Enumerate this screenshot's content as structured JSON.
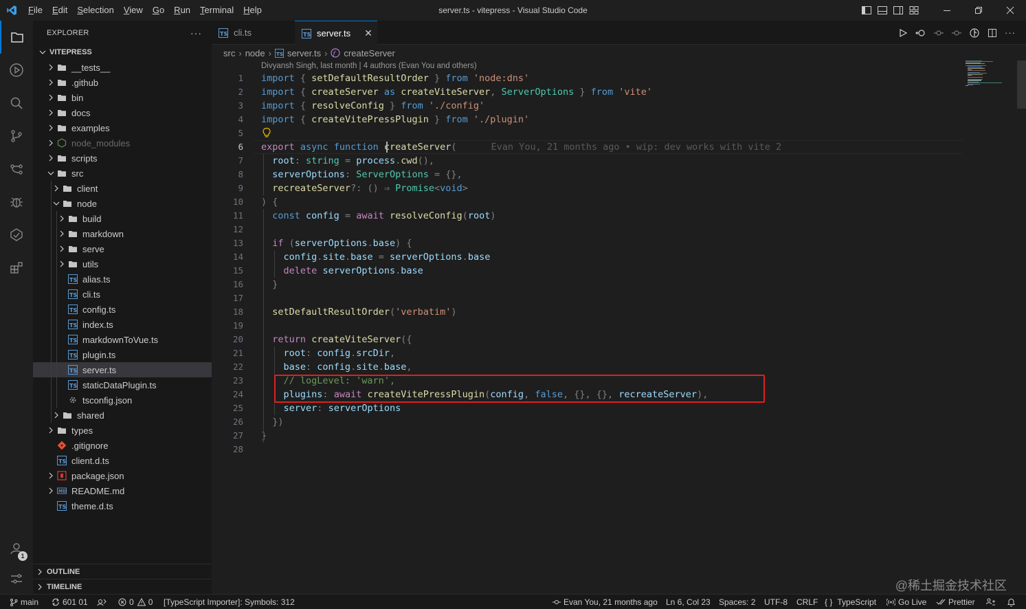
{
  "window": {
    "title": "server.ts - vitepress - Visual Studio Code",
    "menu": [
      {
        "first": "F",
        "rest": "ile"
      },
      {
        "first": "E",
        "rest": "dit"
      },
      {
        "first": "S",
        "rest": "election"
      },
      {
        "first": "V",
        "rest": "iew"
      },
      {
        "first": "G",
        "rest": "o"
      },
      {
        "first": "R",
        "rest": "un"
      },
      {
        "first": "T",
        "rest": "erminal"
      },
      {
        "first": "H",
        "rest": "elp"
      }
    ]
  },
  "sidebar": {
    "title": "EXPLORER",
    "root": "VITEPRESS",
    "outline": "OUTLINE",
    "timeline": "TIMELINE",
    "tree": [
      {
        "label": "__tests__",
        "depth": 0,
        "kind": "folder",
        "open": false
      },
      {
        "label": ".github",
        "depth": 0,
        "kind": "folder",
        "open": false
      },
      {
        "label": "bin",
        "depth": 0,
        "kind": "folder",
        "open": false
      },
      {
        "label": "docs",
        "depth": 0,
        "kind": "folder",
        "open": false
      },
      {
        "label": "examples",
        "depth": 0,
        "kind": "folder",
        "open": false
      },
      {
        "label": "node_modules",
        "depth": 0,
        "kind": "node-folder",
        "open": false,
        "dim": true
      },
      {
        "label": "scripts",
        "depth": 0,
        "kind": "folder",
        "open": false
      },
      {
        "label": "src",
        "depth": 0,
        "kind": "folder",
        "open": true
      },
      {
        "label": "client",
        "depth": 1,
        "kind": "folder",
        "open": false
      },
      {
        "label": "node",
        "depth": 1,
        "kind": "folder",
        "open": true
      },
      {
        "label": "build",
        "depth": 2,
        "kind": "folder",
        "open": false
      },
      {
        "label": "markdown",
        "depth": 2,
        "kind": "folder",
        "open": false
      },
      {
        "label": "serve",
        "depth": 2,
        "kind": "folder",
        "open": false
      },
      {
        "label": "utils",
        "depth": 2,
        "kind": "folder",
        "open": false
      },
      {
        "label": "alias.ts",
        "depth": 2,
        "kind": "ts"
      },
      {
        "label": "cli.ts",
        "depth": 2,
        "kind": "ts"
      },
      {
        "label": "config.ts",
        "depth": 2,
        "kind": "ts"
      },
      {
        "label": "index.ts",
        "depth": 2,
        "kind": "ts"
      },
      {
        "label": "markdownToVue.ts",
        "depth": 2,
        "kind": "ts"
      },
      {
        "label": "plugin.ts",
        "depth": 2,
        "kind": "ts"
      },
      {
        "label": "server.ts",
        "depth": 2,
        "kind": "ts",
        "selected": true
      },
      {
        "label": "staticDataPlugin.ts",
        "depth": 2,
        "kind": "ts"
      },
      {
        "label": "tsconfig.json",
        "depth": 2,
        "kind": "tsconfig"
      },
      {
        "label": "shared",
        "depth": 1,
        "kind": "folder",
        "open": false
      },
      {
        "label": "types",
        "depth": 0,
        "kind": "folder",
        "open": false
      },
      {
        "label": ".gitignore",
        "depth": 0,
        "kind": "git"
      },
      {
        "label": "client.d.ts",
        "depth": 0,
        "kind": "ts"
      },
      {
        "label": "package.json",
        "depth": 0,
        "kind": "npm",
        "chevron": true
      },
      {
        "label": "README.md",
        "depth": 0,
        "kind": "md",
        "chevron": true
      },
      {
        "label": "theme.d.ts",
        "depth": 0,
        "kind": "ts"
      }
    ]
  },
  "tabs": [
    {
      "label": "cli.ts",
      "active": false
    },
    {
      "label": "server.ts",
      "active": true
    }
  ],
  "breadcrumb": {
    "a": "src",
    "b": "node",
    "c": "server.ts",
    "d": "createServer"
  },
  "codelens": "Divyansh Singh, last month | 4 authors (Evan You and others)",
  "blame_inline": "Evan You, 21 months ago • wip: dev works with vite 2",
  "code_lines": [
    [
      [
        "kb",
        "import"
      ],
      [
        "pc",
        " { "
      ],
      [
        "fn",
        "setDefaultResultOrder"
      ],
      [
        "pc",
        " } "
      ],
      [
        "kb",
        "from"
      ],
      [
        "str",
        " 'node:dns'"
      ]
    ],
    [
      [
        "kb",
        "import"
      ],
      [
        "pc",
        " { "
      ],
      [
        "fn",
        "createServer"
      ],
      [
        "kb",
        " as "
      ],
      [
        "fn",
        "createViteServer"
      ],
      [
        "pc",
        ", "
      ],
      [
        "ty",
        "ServerOptions"
      ],
      [
        "pc",
        " } "
      ],
      [
        "kb",
        "from"
      ],
      [
        "str",
        " 'vite'"
      ]
    ],
    [
      [
        "kb",
        "import"
      ],
      [
        "pc",
        " { "
      ],
      [
        "fn",
        "resolveConfig"
      ],
      [
        "pc",
        " } "
      ],
      [
        "kb",
        "from"
      ],
      [
        "str",
        " './config'"
      ]
    ],
    [
      [
        "kb",
        "import"
      ],
      [
        "pc",
        " { "
      ],
      [
        "fn",
        "createVitePressPlugin"
      ],
      [
        "pc",
        " } "
      ],
      [
        "kb",
        "from"
      ],
      [
        "str",
        " './plugin'"
      ]
    ],
    [],
    [
      [
        "k",
        "export"
      ],
      [
        "kb",
        " async"
      ],
      [
        "kb",
        " function"
      ],
      [
        "pc",
        " "
      ],
      [
        "fn",
        "createServer"
      ],
      [
        "pc",
        "("
      ]
    ],
    [
      [
        "pc",
        "  "
      ],
      [
        "vr",
        "root"
      ],
      [
        "pc",
        ": "
      ],
      [
        "ty",
        "string"
      ],
      [
        "pc",
        " = "
      ],
      [
        "vr",
        "process"
      ],
      [
        "pc",
        "."
      ],
      [
        "fn",
        "cwd"
      ],
      [
        "pc",
        "(),"
      ]
    ],
    [
      [
        "pc",
        "  "
      ],
      [
        "vr",
        "serverOptions"
      ],
      [
        "pc",
        ": "
      ],
      [
        "ty",
        "ServerOptions"
      ],
      [
        "pc",
        " = {},"
      ]
    ],
    [
      [
        "pc",
        "  "
      ],
      [
        "fn",
        "recreateServer"
      ],
      [
        "pc",
        "?: () ⇒ "
      ],
      [
        "ty",
        "Promise"
      ],
      [
        "pc",
        "<"
      ],
      [
        "kb",
        "void"
      ],
      [
        "pc",
        ">"
      ]
    ],
    [
      [
        "pc",
        ") {"
      ]
    ],
    [
      [
        "pc",
        "  "
      ],
      [
        "kb",
        "const"
      ],
      [
        "pc",
        " "
      ],
      [
        "vr",
        "config"
      ],
      [
        "pc",
        " = "
      ],
      [
        "k",
        "await"
      ],
      [
        "pc",
        " "
      ],
      [
        "fn",
        "resolveConfig"
      ],
      [
        "pc",
        "("
      ],
      [
        "vr",
        "root"
      ],
      [
        "pc",
        ")"
      ]
    ],
    [],
    [
      [
        "pc",
        "  "
      ],
      [
        "k",
        "if"
      ],
      [
        "pc",
        " ("
      ],
      [
        "vr",
        "serverOptions"
      ],
      [
        "pc",
        "."
      ],
      [
        "vr",
        "base"
      ],
      [
        "pc",
        ") {"
      ]
    ],
    [
      [
        "pc",
        "    "
      ],
      [
        "vr",
        "config"
      ],
      [
        "pc",
        "."
      ],
      [
        "vr",
        "site"
      ],
      [
        "pc",
        "."
      ],
      [
        "vr",
        "base"
      ],
      [
        "pc",
        " = "
      ],
      [
        "vr",
        "serverOptions"
      ],
      [
        "pc",
        "."
      ],
      [
        "vr",
        "base"
      ]
    ],
    [
      [
        "pc",
        "    "
      ],
      [
        "k",
        "delete"
      ],
      [
        "pc",
        " "
      ],
      [
        "vr",
        "serverOptions"
      ],
      [
        "pc",
        "."
      ],
      [
        "vr",
        "base"
      ]
    ],
    [
      [
        "pc",
        "  }"
      ]
    ],
    [],
    [
      [
        "pc",
        "  "
      ],
      [
        "fn",
        "setDefaultResultOrder"
      ],
      [
        "pc",
        "("
      ],
      [
        "str",
        "'verbatim'"
      ],
      [
        "pc",
        ")"
      ]
    ],
    [],
    [
      [
        "pc",
        "  "
      ],
      [
        "k",
        "return"
      ],
      [
        "pc",
        " "
      ],
      [
        "fn",
        "createViteServer"
      ],
      [
        "pc",
        "({"
      ]
    ],
    [
      [
        "pc",
        "    "
      ],
      [
        "vr",
        "root"
      ],
      [
        "pc",
        ": "
      ],
      [
        "vr",
        "config"
      ],
      [
        "pc",
        "."
      ],
      [
        "vr",
        "srcDir"
      ],
      [
        "pc",
        ","
      ]
    ],
    [
      [
        "pc",
        "    "
      ],
      [
        "vr",
        "base"
      ],
      [
        "pc",
        ": "
      ],
      [
        "vr",
        "config"
      ],
      [
        "pc",
        "."
      ],
      [
        "vr",
        "site"
      ],
      [
        "pc",
        "."
      ],
      [
        "vr",
        "base"
      ],
      [
        "pc",
        ","
      ]
    ],
    [
      [
        "pc",
        "    "
      ],
      [
        "cm",
        "// logLevel: 'warn',"
      ]
    ],
    [
      [
        "pc",
        "    "
      ],
      [
        "vr",
        "plugins"
      ],
      [
        "pc",
        ": "
      ],
      [
        "k",
        "await"
      ],
      [
        "pc",
        " "
      ],
      [
        "fn",
        "createVitePressPlugin"
      ],
      [
        "pc",
        "("
      ],
      [
        "vr",
        "config"
      ],
      [
        "pc",
        ", "
      ],
      [
        "kb",
        "false"
      ],
      [
        "pc",
        ", {}, {}, "
      ],
      [
        "vr",
        "recreateServer"
      ],
      [
        "pc",
        "),"
      ]
    ],
    [
      [
        "pc",
        "    "
      ],
      [
        "vr",
        "server"
      ],
      [
        "pc",
        ": "
      ],
      [
        "vr",
        "serverOptions"
      ]
    ],
    [
      [
        "pc",
        "  })"
      ]
    ],
    [
      [
        "pc",
        "}"
      ]
    ],
    []
  ],
  "current_line": 6,
  "status": {
    "branch": "main",
    "sync": "601 01",
    "errors": "0",
    "warnings": "0",
    "importer": "[TypeScript Importer]: Symbols: 312",
    "blame": "Evan You, 21 months ago",
    "position": "Ln 6, Col 23",
    "spaces": "Spaces: 2",
    "encoding": "UTF-8",
    "eol": "CRLF",
    "language": "TypeScript",
    "golive": "Go Live",
    "prettier": "Prettier"
  },
  "watermark": "@稀土掘金技术社区",
  "accounts_badge": "1"
}
